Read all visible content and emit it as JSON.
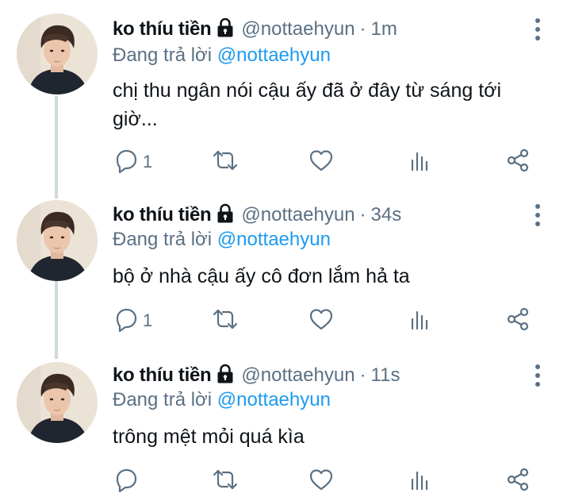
{
  "tweets": [
    {
      "name": "ko thíu tiền",
      "handle": "@nottaehyun",
      "separator": "·",
      "time": "1m",
      "reply_prefix": "Đang trả lời",
      "reply_to": "@nottaehyun",
      "text": "chị thu ngân nói cậu ấy đã ở đây từ sáng tới giờ...",
      "reply_count": "1",
      "protected": true
    },
    {
      "name": "ko thíu tiền",
      "handle": "@nottaehyun",
      "separator": "·",
      "time": "34s",
      "reply_prefix": "Đang trả lời",
      "reply_to": "@nottaehyun",
      "text": "bộ ở nhà cậu ấy cô đơn lắm hả ta",
      "reply_count": "1",
      "protected": true
    },
    {
      "name": "ko thíu tiền",
      "handle": "@nottaehyun",
      "separator": "·",
      "time": "11s",
      "reply_prefix": "Đang trả lời",
      "reply_to": "@nottaehyun",
      "text": "trông mệt mỏi quá kìa",
      "reply_count": "",
      "protected": true
    }
  ],
  "icons": {
    "lock": "lock-icon",
    "more": "more-vertical-icon",
    "reply": "reply-bubble-icon",
    "retweet": "retweet-icon",
    "like": "heart-icon",
    "stats": "bar-chart-icon",
    "share": "share-icon"
  },
  "colors": {
    "text": "#0f1419",
    "secondary": "#5b7083",
    "mention": "#1d9bf0",
    "thread_line": "#cfd9de"
  }
}
